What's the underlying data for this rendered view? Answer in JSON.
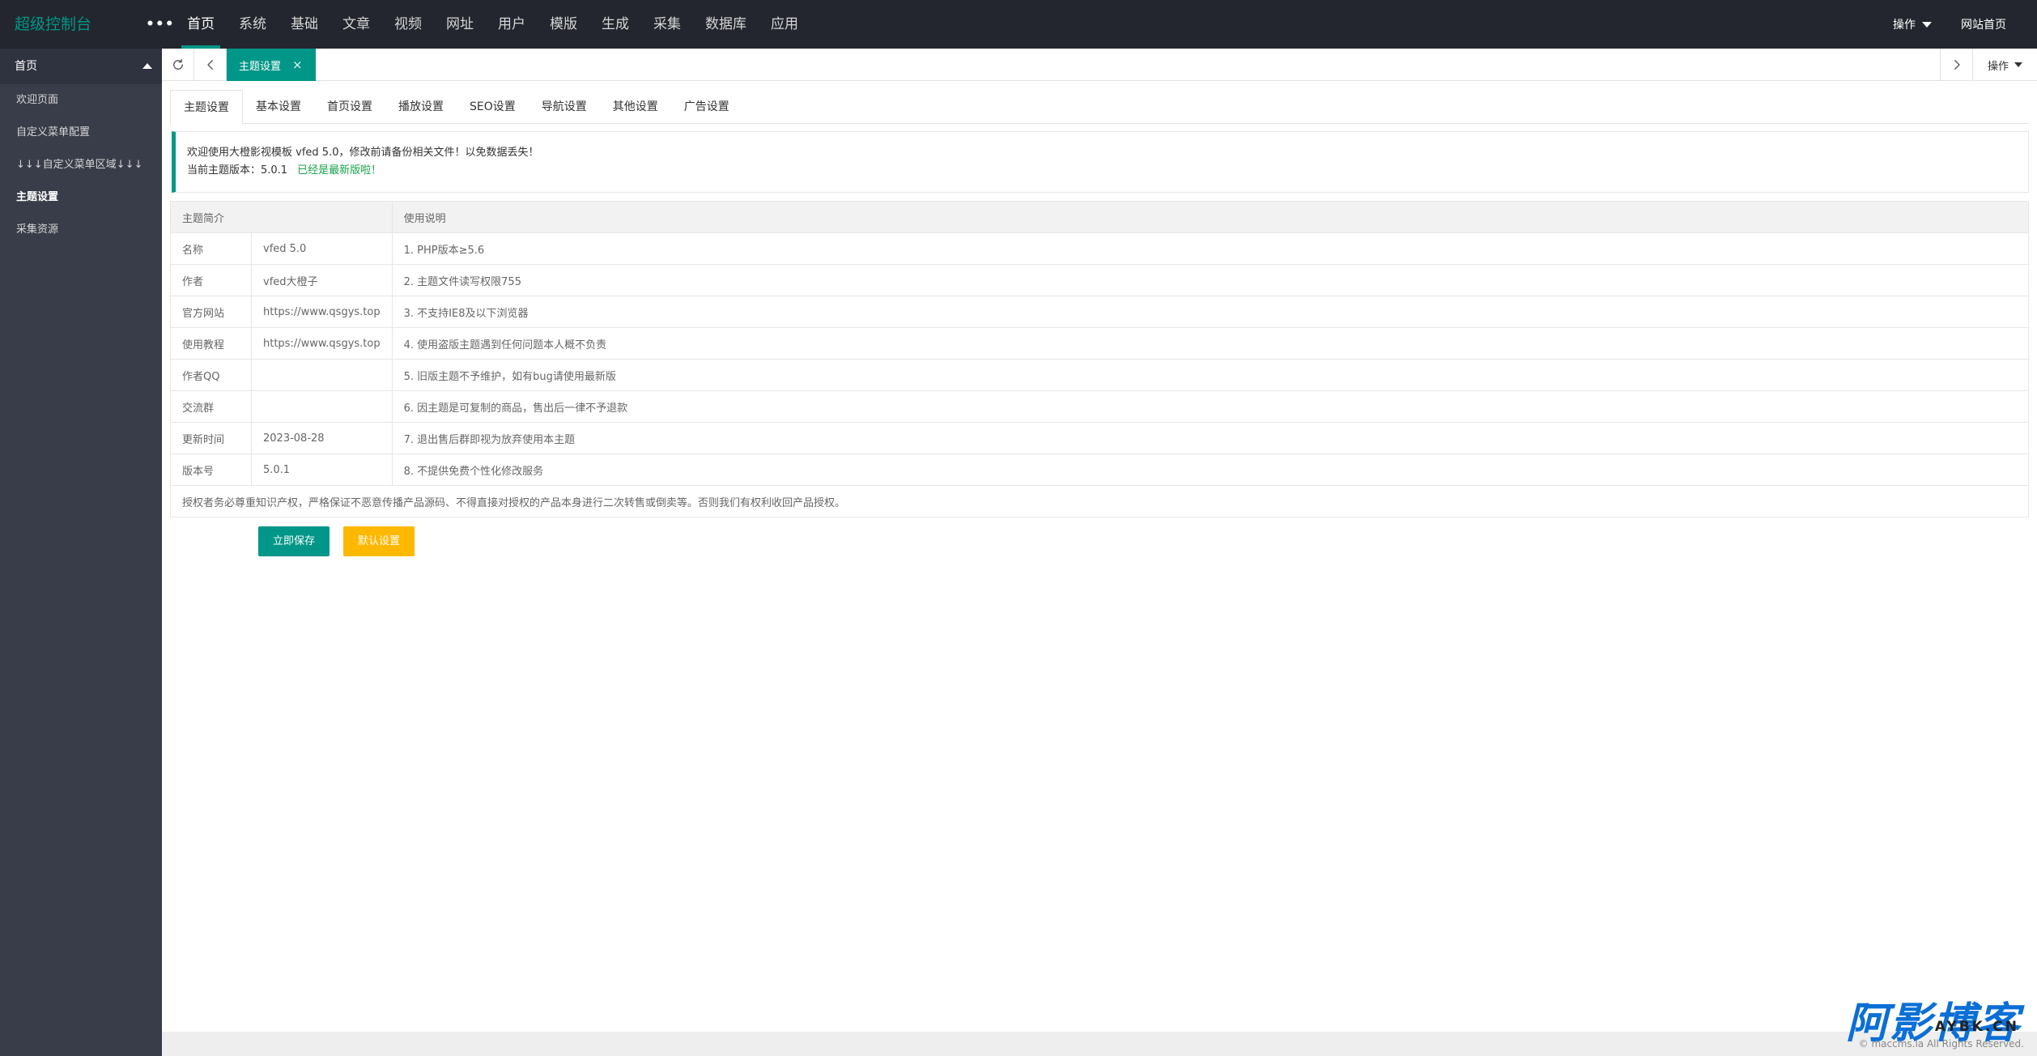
{
  "header": {
    "logo": "超级控制台",
    "more": "•••",
    "nav": [
      {
        "label": "首页",
        "active": true
      },
      {
        "label": "系统"
      },
      {
        "label": "基础"
      },
      {
        "label": "文章"
      },
      {
        "label": "视频"
      },
      {
        "label": "网址"
      },
      {
        "label": "用户"
      },
      {
        "label": "模版"
      },
      {
        "label": "生成"
      },
      {
        "label": "采集"
      },
      {
        "label": "数据库"
      },
      {
        "label": "应用"
      }
    ],
    "right": {
      "operate": "操作",
      "site_home": "网站首页"
    }
  },
  "sidebar": {
    "group": "首页",
    "items": [
      "欢迎页面",
      "自定义菜单配置",
      "↓↓↓自定义菜单区域↓↓↓",
      "主题设置",
      "采集资源"
    ],
    "active_index": 3
  },
  "tabbar": {
    "current_tab": "主题设置",
    "close": "×",
    "operate": "操作"
  },
  "subtabs": [
    "主题设置",
    "基本设置",
    "首页设置",
    "播放设置",
    "SEO设置",
    "导航设置",
    "其他设置",
    "广告设置"
  ],
  "notice": {
    "line1": "欢迎使用大橙影视模板 vfed 5.0，修改前请备份相关文件！以免数据丢失！",
    "line2_prefix": "当前主题版本：5.0.1",
    "line2_status": "已经是最新版啦！"
  },
  "table": {
    "header_left": "主题简介",
    "header_right": "使用说明",
    "rows": [
      {
        "label": "名称",
        "value": "vfed 5.0",
        "note": "1. PHP版本≥5.6"
      },
      {
        "label": "作者",
        "value": "vfed大橙子",
        "note": "2. 主题文件读写权限755"
      },
      {
        "label": "官方网站",
        "value": "https://www.qsgys.top",
        "note": "3. 不支持IE8及以下浏览器"
      },
      {
        "label": "使用教程",
        "value": "https://www.qsgys.top",
        "note": "4. 使用盗版主题遇到任何问题本人概不负责"
      },
      {
        "label": "作者QQ",
        "value": "",
        "note": "5. 旧版主题不予维护，如有bug请使用最新版"
      },
      {
        "label": "交流群",
        "value": "",
        "note": "6. 因主题是可复制的商品，售出后一律不予退款"
      },
      {
        "label": "更新时间",
        "value": "2023-08-28",
        "note": "7. 退出售后群即视为放弃使用本主题"
      },
      {
        "label": "版本号",
        "value": "5.0.1",
        "note": "8. 不提供免费个性化修改服务"
      }
    ],
    "footer": "授权者务必尊重知识产权，严格保证不恶意传播产品源码、不得直接对授权的产品本身进行二次转售或倒卖等。否则我们有权利收回产品授权。"
  },
  "buttons": {
    "save": "立即保存",
    "default": "默认设置"
  },
  "footer": {
    "text": "© maccms.la All Rights Reserved."
  },
  "watermark": {
    "main": "阿影博客",
    "sub": "AYBK.CN"
  }
}
